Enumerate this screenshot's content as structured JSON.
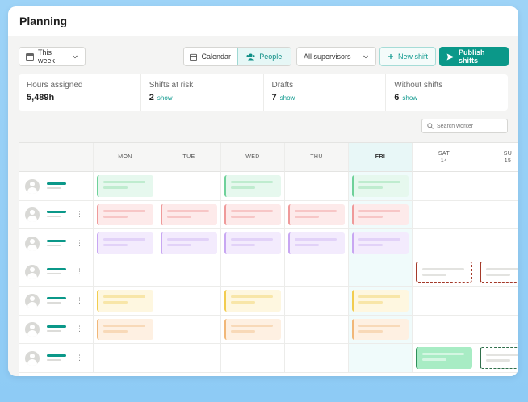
{
  "app": {
    "title": "Planning"
  },
  "toolbar": {
    "week_label": "This week",
    "calendar_label": "Calendar",
    "people_label": "People",
    "supervisor_label": "All supervisors",
    "new_shift_label": "New shift",
    "publish_label": "Publish shifts"
  },
  "stats": [
    {
      "label": "Hours assigned",
      "value": "5,489h",
      "link": ""
    },
    {
      "label": "Shifts at risk",
      "value": "2",
      "link": "show"
    },
    {
      "label": "Drafts",
      "value": "7",
      "link": "show"
    },
    {
      "label": "Without shifts",
      "value": "6",
      "link": "show"
    }
  ],
  "search": {
    "placeholder": "Search worker"
  },
  "days": [
    {
      "label": "MON",
      "num": "",
      "today": false,
      "weekend": false
    },
    {
      "label": "TUE",
      "num": "",
      "today": false,
      "weekend": false
    },
    {
      "label": "WED",
      "num": "",
      "today": false,
      "weekend": false
    },
    {
      "label": "THU",
      "num": "",
      "today": false,
      "weekend": false
    },
    {
      "label": "FRI",
      "num": "",
      "today": true,
      "weekend": false
    },
    {
      "label": "SAT",
      "num": "14",
      "today": false,
      "weekend": true
    },
    {
      "label": "SU",
      "num": "15",
      "today": false,
      "weekend": true
    }
  ],
  "colors": {
    "green": {
      "bg": "#e6f8ee",
      "border": "#6fd19a",
      "line": "#bfeccf"
    },
    "red": {
      "bg": "#fdeaea",
      "border": "#ef9a9a",
      "line": "#f7c6c6"
    },
    "purple": {
      "bg": "#f3ebfd",
      "border": "#c8a7f2",
      "line": "#e2d2f8"
    },
    "yellow": {
      "bg": "#fef7e0",
      "border": "#f2cc4f",
      "line": "#f8e6a8"
    },
    "orange": {
      "bg": "#fef0e2",
      "border": "#f1b778",
      "line": "#f8d9b8"
    },
    "risk": {
      "bg": "#ffffff",
      "border": "#a53a2a",
      "line": "#e3e3e0"
    },
    "solid": {
      "bg": "#a8ecc4",
      "border": "#2f8f5a",
      "line": "#d4f6e2"
    },
    "solid_dash": {
      "bg": "#ffffff",
      "border": "#2f6f4a",
      "line": "#e3e3e0"
    }
  },
  "rows": [
    {
      "kebab": false,
      "shifts": [
        [
          "green",
          0
        ],
        [
          "green",
          2
        ],
        [
          "green",
          4
        ]
      ]
    },
    {
      "kebab": true,
      "shifts": [
        [
          "red",
          0
        ],
        [
          "red",
          1
        ],
        [
          "red",
          2
        ],
        [
          "red",
          3
        ],
        [
          "red",
          4
        ]
      ]
    },
    {
      "kebab": true,
      "shifts": [
        [
          "purple",
          0
        ],
        [
          "purple",
          1
        ],
        [
          "purple",
          2
        ],
        [
          "purple",
          3
        ],
        [
          "purple",
          4
        ]
      ]
    },
    {
      "kebab": true,
      "shifts": [
        [
          "risk",
          5
        ],
        [
          "risk",
          6
        ]
      ]
    },
    {
      "kebab": true,
      "shifts": [
        [
          "yellow",
          0
        ],
        [
          "yellow",
          2
        ],
        [
          "yellow",
          4
        ]
      ]
    },
    {
      "kebab": true,
      "shifts": [
        [
          "orange",
          0
        ],
        [
          "orange",
          2
        ],
        [
          "orange",
          4
        ]
      ]
    },
    {
      "kebab": true,
      "shifts": [
        [
          "solid",
          5
        ],
        [
          "solid_dash",
          6
        ]
      ]
    }
  ]
}
